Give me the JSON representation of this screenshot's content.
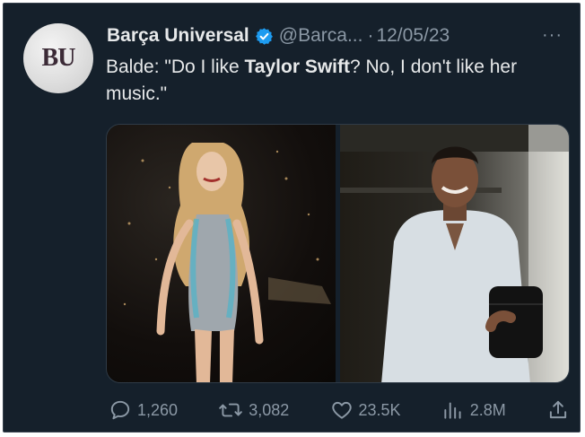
{
  "tweet": {
    "author_name": "Barça Universal",
    "avatar_text": "BU",
    "handle": "@Barca...",
    "separator": "·",
    "date": "12/05/23",
    "more_label": "···",
    "text_part1": "Balde: \"Do I like ",
    "text_bold": "Taylor Swift",
    "text_part2": "? No, I don't like her music.\""
  },
  "actions": {
    "replies": "1,260",
    "reposts": "3,082",
    "likes": "23.5K",
    "views": "2.8M"
  },
  "colors": {
    "background": "#15202b",
    "primary_text": "#e7e9ea",
    "secondary_text": "#8b98a5",
    "verified": "#1d9bf0"
  },
  "icons": {
    "verified": "verified-badge-icon",
    "reply": "reply-icon",
    "repost": "repost-icon",
    "like": "heart-icon",
    "views": "views-chart-icon",
    "share": "share-icon"
  }
}
